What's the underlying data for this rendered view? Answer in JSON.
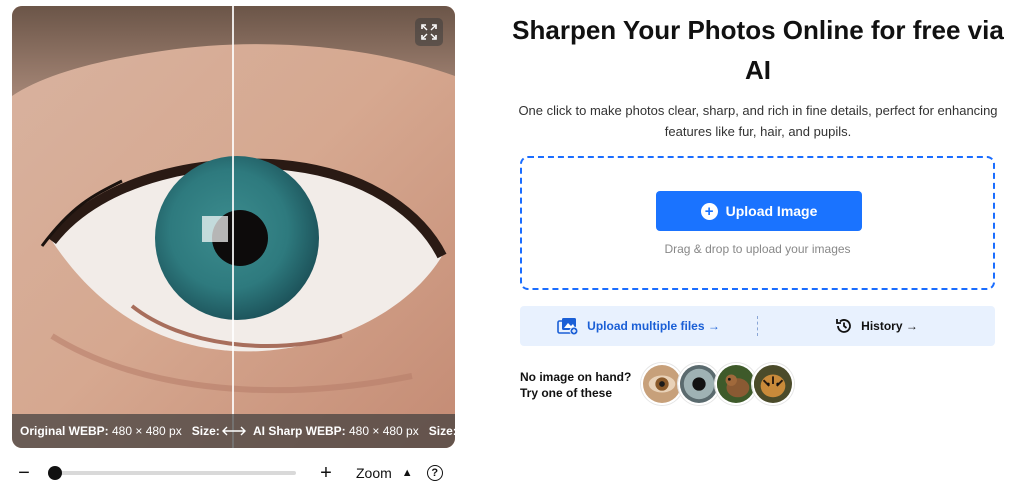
{
  "viewer": {
    "expand_icon": "expand-icon",
    "original_label": "Original WEBP:",
    "original_dims": " 480 × 480 px",
    "original_size": "Size:...",
    "sharp_label": "AI Sharp WEBP:",
    "sharp_dims": " 480 × 480 px",
    "sharp_size": "Size: ...",
    "swap_icon": "swap-arrows-icon"
  },
  "zoombar": {
    "minus": "−",
    "plus": "+",
    "zoom_label": "Zoom",
    "caret": "▲",
    "help": "?",
    "zoom_level": 0.0
  },
  "hero": {
    "title": "Sharpen Your Photos Online for free via AI",
    "subtitle": "One click to make photos clear, sharp, and rich in fine details, perfect for enhancing features like fur, hair, and pupils."
  },
  "upload": {
    "button_label": "Upload Image",
    "plus_icon": "+",
    "drag_hint": "Drag & drop to upload your images",
    "accent": "#1a73ff"
  },
  "actions": {
    "multiple_label": "Upload multiple files →",
    "history_label": "History →"
  },
  "samples": {
    "label_line1": "No image on hand?",
    "label_line2": "Try one of these"
  }
}
